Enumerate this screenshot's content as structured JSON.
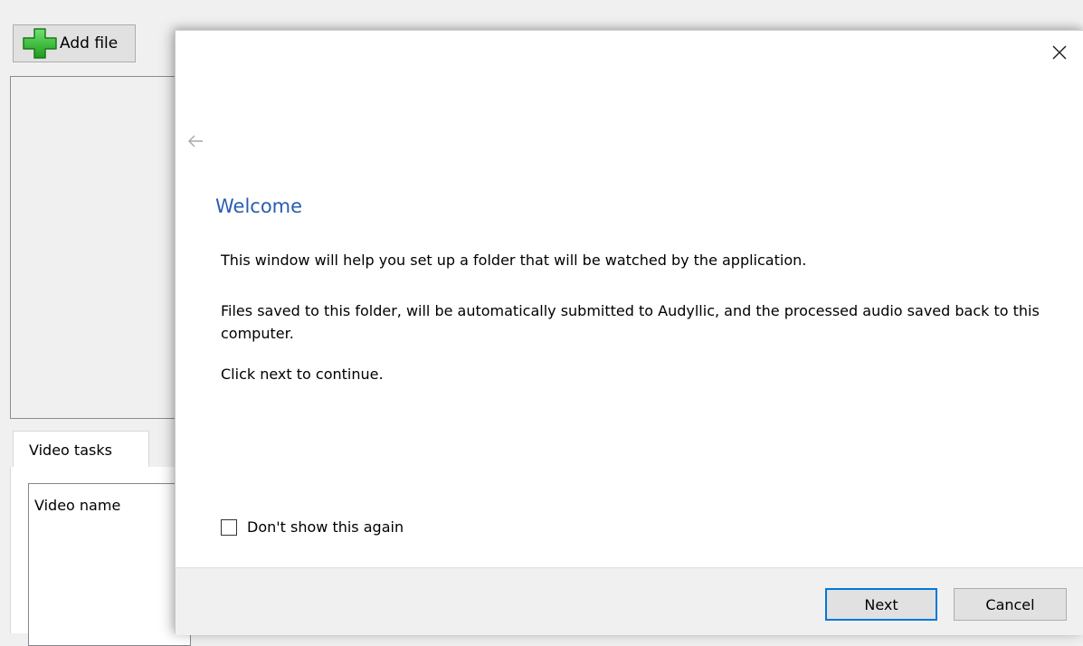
{
  "background_app": {
    "add_file_label": "Add file",
    "tab_label": "Video tasks",
    "list_column_header": "Video name"
  },
  "dialog": {
    "title": "Welcome",
    "paragraphs": {
      "intro": "This window will help you set up a folder that will be watched by the application.",
      "files": "Files saved to this folder, will be automatically submitted to Audyllic, and the processed audio saved back to this computer.",
      "continue": "Click next to continue."
    },
    "checkbox_label": "Don't show this again",
    "checkbox_checked": false,
    "next_label": "Next",
    "cancel_label": "Cancel"
  },
  "icons": {
    "add": "plus-icon",
    "close": "close-icon",
    "back": "back-arrow-icon",
    "checkbox": "checkbox-icon"
  },
  "colors": {
    "heading": "#2a5db0",
    "default_button_border": "#0078d7",
    "plus_icon_green": "#2fb52f"
  }
}
